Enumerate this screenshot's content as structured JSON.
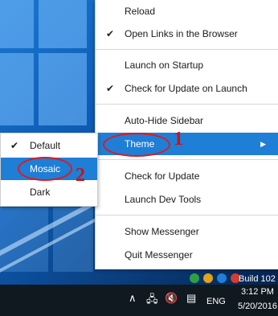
{
  "menu": {
    "items": [
      {
        "label": "Reload",
        "checked": false
      },
      {
        "label": "Open Links in the Browser",
        "checked": true
      },
      {
        "label": "Launch on Startup",
        "checked": false
      },
      {
        "label": "Check for Update on Launch",
        "checked": true
      },
      {
        "label": "Auto-Hide Sidebar",
        "checked": false
      },
      {
        "label": "Theme",
        "checked": false,
        "submenu_arrow": "▶"
      },
      {
        "label": "Check for Update",
        "checked": false
      },
      {
        "label": "Launch Dev Tools",
        "checked": false
      },
      {
        "label": "Show Messenger",
        "checked": false
      },
      {
        "label": "Quit Messenger",
        "checked": false
      }
    ],
    "check_glyph": "✔"
  },
  "submenu": {
    "items": [
      {
        "label": "Default",
        "checked": true
      },
      {
        "label": "Mosaic",
        "checked": false
      },
      {
        "label": "Dark",
        "checked": false
      }
    ]
  },
  "annotations": {
    "one": "1",
    "two": "2"
  },
  "taskbar": {
    "build": "Build 102",
    "time": "3:12 PM",
    "date_line": "5/20/2016",
    "date_partial": "5/20/201",
    "lang": "ENG",
    "icons": [
      "chevron-up-icon",
      "network-icon",
      "volume-muted-icon",
      "notification-icon"
    ]
  },
  "colors": {
    "highlight": "#1f7ed6",
    "annotation": "#d01010",
    "taskbar": "#101820"
  }
}
